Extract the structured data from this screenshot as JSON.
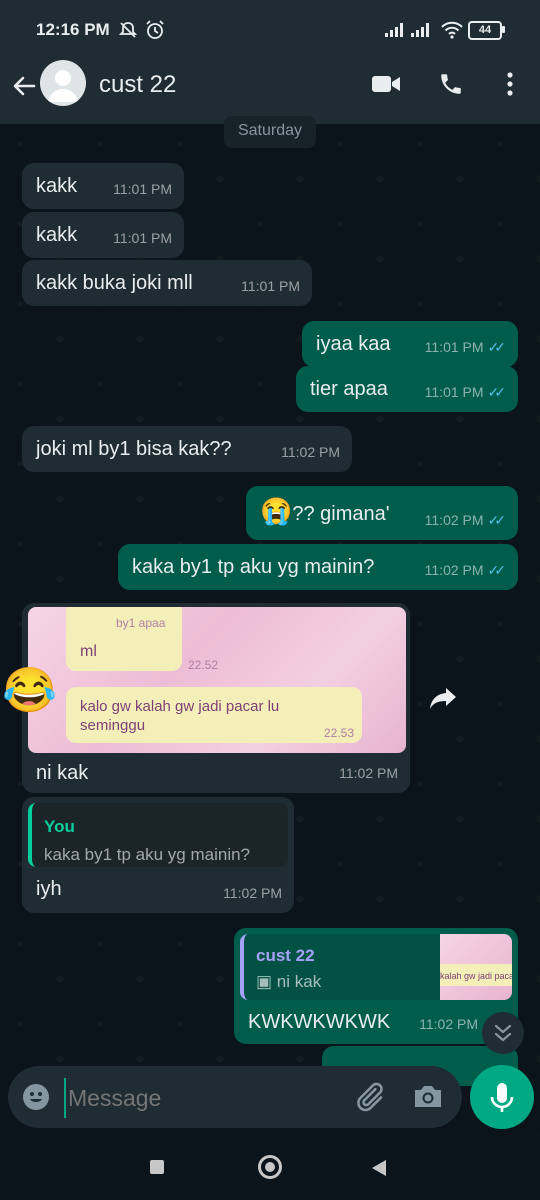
{
  "status_bar": {
    "time": "12:16 PM",
    "battery": "44"
  },
  "header": {
    "contact_name": "cust 22"
  },
  "date_chip": "Saturday",
  "messages": [
    {
      "text": "kakk",
      "time": "11:01 PM"
    },
    {
      "text": "kakk",
      "time": "11:01 PM"
    },
    {
      "text": "kakk buka joki mll",
      "time": "11:01 PM"
    },
    {
      "text": "iyaa kaa",
      "time": "11:01 PM"
    },
    {
      "text": "tier apaa",
      "time": "11:01 PM"
    },
    {
      "text": "joki ml by1 bisa kak??",
      "time": "11:02 PM"
    },
    {
      "text": "?? gimana'",
      "emoji": "😭",
      "time": "11:02 PM"
    },
    {
      "text": "kaka by1 tp aku yg mainin?",
      "time": "11:02 PM"
    },
    {
      "text": "ni kak",
      "time": "11:02 PM",
      "image": {
        "bubble1_text": "by1 apaa",
        "bubble2_text": "ml",
        "bubble2_time": "22.52",
        "bubble3_text": "kalo gw kalah gw jadi pacar lu seminggu",
        "bubble3_time": "22.53"
      },
      "reaction": "😂"
    },
    {
      "text": "iyh",
      "time": "11:02 PM",
      "quote": {
        "author": "You",
        "text": "kaka by1 tp aku yg mainin?"
      }
    },
    {
      "text": "KWKWKWKWK",
      "time": "11:02 PM",
      "quote": {
        "author": "cust 22",
        "text": "ni kak",
        "thumb_text": "kalah gw jadi pacar"
      }
    }
  ],
  "composer": {
    "placeholder": "Message"
  },
  "colors": {
    "incoming": "#202c33",
    "outgoing": "#005c4b",
    "accent": "#00a884",
    "read_ticks": "#53bdeb"
  }
}
